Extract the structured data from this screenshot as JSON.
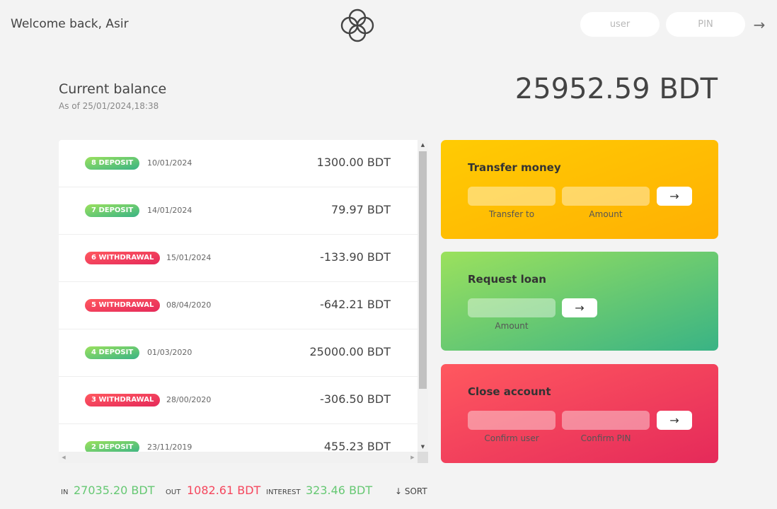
{
  "nav": {
    "welcome": "Welcome back, Asir",
    "user_placeholder": "user",
    "pin_placeholder": "PIN",
    "login_icon": "arrow-right-icon",
    "login_label": "→"
  },
  "balance": {
    "label": "Current balance",
    "date": "As of 25/01/2024,18:38",
    "value": "25952.59 BDT"
  },
  "movements": [
    {
      "type": "8 DEPOSIT",
      "kind": "deposit",
      "date": "10/01/2024",
      "value": "1300.00 BDT"
    },
    {
      "type": "7 DEPOSIT",
      "kind": "deposit",
      "date": "14/01/2024",
      "value": "79.97 BDT"
    },
    {
      "type": "6 WITHDRAWAL",
      "kind": "withdrawal",
      "date": "15/01/2024",
      "value": "-133.90 BDT"
    },
    {
      "type": "5 WITHDRAWAL",
      "kind": "withdrawal",
      "date": "08/04/2020",
      "value": "-642.21 BDT"
    },
    {
      "type": "4 DEPOSIT",
      "kind": "deposit",
      "date": "01/03/2020",
      "value": "25000.00 BDT"
    },
    {
      "type": "3 WITHDRAWAL",
      "kind": "withdrawal",
      "date": "28/00/2020",
      "value": "-306.50 BDT"
    },
    {
      "type": "2 DEPOSIT",
      "kind": "deposit",
      "date": "23/11/2019",
      "value": "455.23 BDT"
    }
  ],
  "operations": {
    "transfer": {
      "title": "Transfer money",
      "label_to": "Transfer to",
      "label_amount": "Amount",
      "btn": "→"
    },
    "loan": {
      "title": "Request loan",
      "label_amount": "Amount",
      "btn": "→"
    },
    "close": {
      "title": "Close account",
      "label_user": "Confirm user",
      "label_pin": "Confirm PIN",
      "btn": "→"
    }
  },
  "summary": {
    "in_label": "In",
    "in_value": "27035.20 BDT",
    "out_label": "Out",
    "out_value": "1082.61 BDT",
    "interest_label": "Interest",
    "interest_value": "323.46 BDT",
    "sort_label": "↓ SORT"
  },
  "colors": {
    "deposit": "#66c873",
    "withdrawal": "#f5465d",
    "transfer_card": "#ffbf03",
    "loan_card": "#6cc66f",
    "close_card": "#f0405c"
  }
}
